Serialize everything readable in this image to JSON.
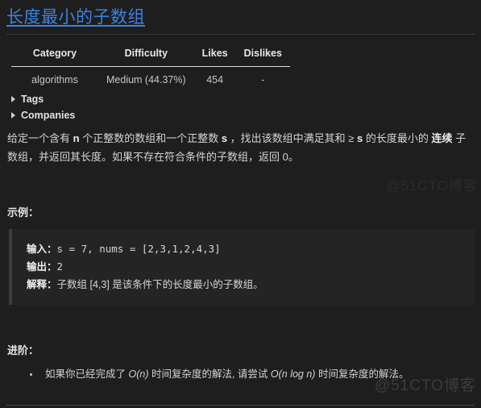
{
  "problem": {
    "title": "长度最小的子数组"
  },
  "meta_table": {
    "headers": [
      "Category",
      "Difficulty",
      "Likes",
      "Dislikes"
    ],
    "rows": [
      {
        "category": "algorithms",
        "difficulty": "Medium (44.37%)",
        "likes": "454",
        "dislikes": "-"
      }
    ]
  },
  "collapsibles": [
    {
      "label": "Tags",
      "marker": "triangle-right-icon",
      "expanded": false
    },
    {
      "label": "Companies",
      "marker": "triangle-right-icon",
      "expanded": false
    }
  ],
  "description": {
    "part1": "给定一个含有 ",
    "bold_n": "n",
    "part2": " 个正整数的数组和一个正整数 ",
    "bold_s": "s",
    "part3": " ，找出该数组中满足其和 ≥ ",
    "bold_s2": "s",
    "part4": " 的长度最小的 ",
    "bold_continuous": "连续",
    "part5": " 子数组，并返回其长度。如果不存在符合条件的子数组，返回 0。"
  },
  "example": {
    "heading": "示例：",
    "input_label": "输入：",
    "input_value": "s = 7, nums = [2,3,1,2,4,3]",
    "output_label": "输出：",
    "output_value": "2",
    "explain_label": "解释：",
    "explain_value": "子数组 [4,3] 是该条件下的长度最小的子数组。"
  },
  "advanced": {
    "heading": "进阶：",
    "items": [
      {
        "part1": "如果你已经完成了 ",
        "complexity1": "O(n)",
        "part2": " 时间复杂度的解法, 请尝试 ",
        "complexity2": "O(n log n)",
        "part3": " 时间复杂度的解法。"
      }
    ]
  },
  "watermark": {
    "text": "@51CTO博客"
  },
  "colors": {
    "background": "#1e1e1e",
    "link": "#3a82e0",
    "text": "#d4d4d4",
    "code_background": "#242424",
    "rule": "#3a3a3a"
  }
}
